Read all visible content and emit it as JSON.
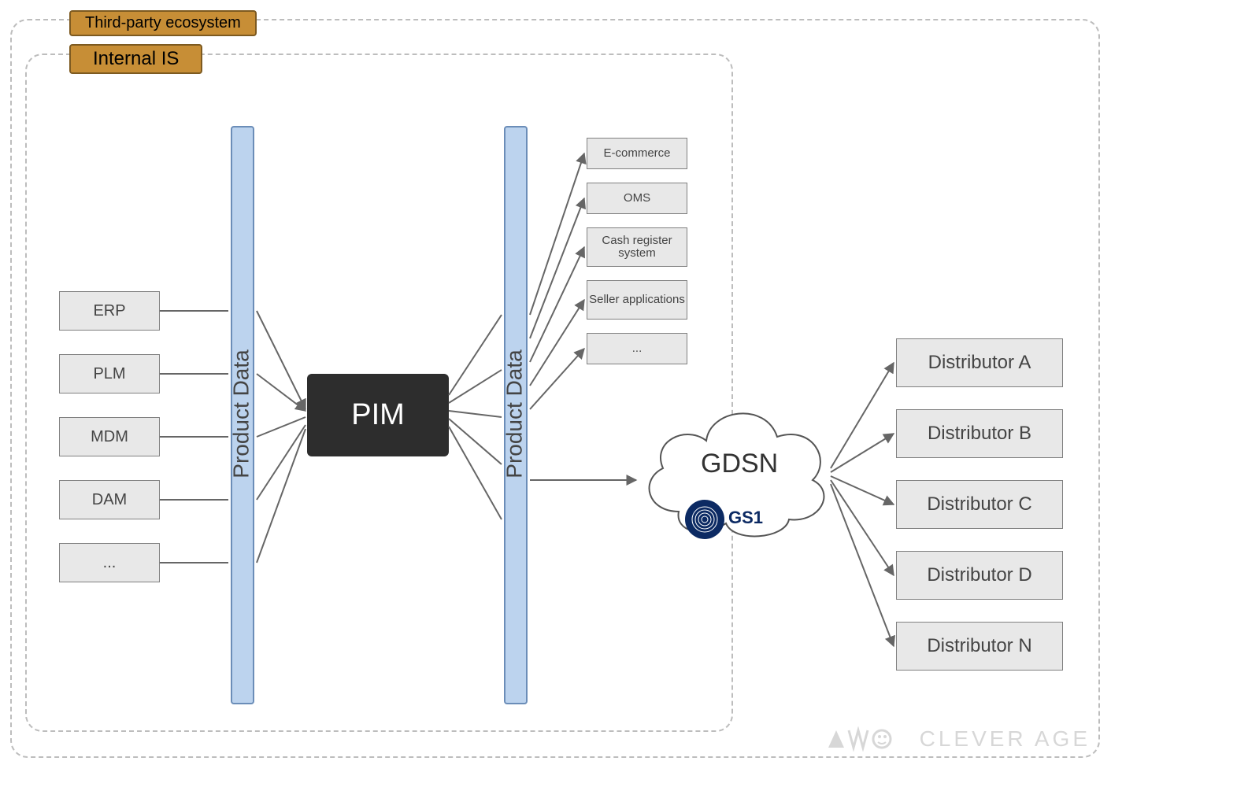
{
  "frames": {
    "outer": "Third-party ecosystem",
    "inner": "Internal IS"
  },
  "sources": [
    "ERP",
    "PLM",
    "MDM",
    "DAM",
    "..."
  ],
  "bar1": "Product Data",
  "pim": "PIM",
  "bar2": "Product Data",
  "outputs": [
    "E-commerce",
    "OMS",
    "Cash register system",
    "Seller applications",
    "..."
  ],
  "cloud": {
    "label": "GDSN",
    "badge": "1",
    "badge_prefix": "GS"
  },
  "distributors": [
    "Distributor A",
    "Distributor B",
    "Distributor C",
    "Distributor D",
    "Distributor N"
  ],
  "watermark": "CLEVER AGE"
}
